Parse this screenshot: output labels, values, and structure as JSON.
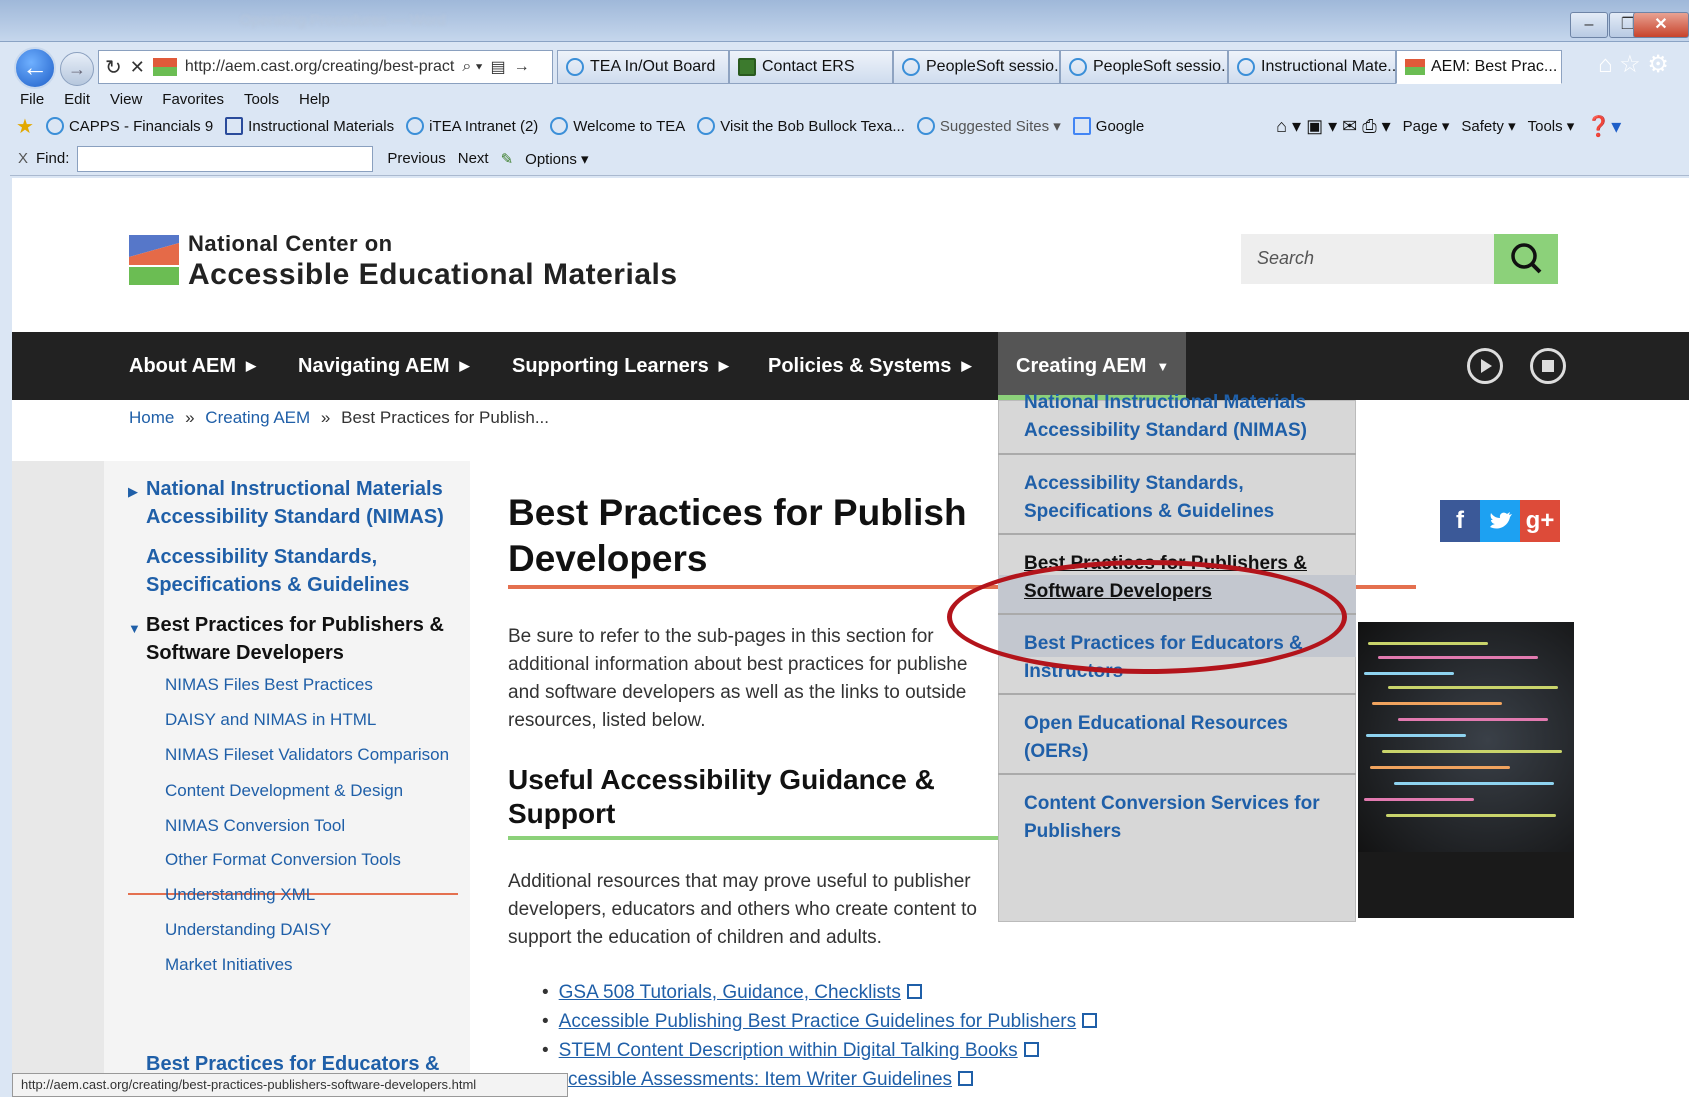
{
  "browser": {
    "address_url": "http://aem.cast.org/creating/best-pract",
    "tabs": [
      {
        "label": "TEA In/Out Board"
      },
      {
        "label": "Contact ERS"
      },
      {
        "label": "PeopleSoft sessio..."
      },
      {
        "label": "PeopleSoft sessio..."
      },
      {
        "label": "Instructional Mate..."
      },
      {
        "label": "AEM: Best Prac...",
        "close": "×"
      }
    ],
    "menu": [
      "File",
      "Edit",
      "View",
      "Favorites",
      "Tools",
      "Help"
    ],
    "favorites": [
      "CAPPS - Financials 9",
      "Instructional Materials",
      "iTEA Intranet (2)",
      "Welcome to TEA",
      "Visit the Bob Bullock Texa...",
      "Suggested Sites ▾",
      "Google"
    ],
    "command_bar": [
      "Page ▾",
      "Safety ▾",
      "Tools ▾"
    ],
    "find": {
      "close": "X",
      "label": "Find:",
      "previous": "Previous",
      "next": "Next",
      "options": "Options ▾"
    },
    "status_url": "http://aem.cast.org/creating/best-practices-publishers-software-developers.html"
  },
  "site": {
    "logo_line1": "National Center on",
    "logo_line2": "Accessible Educational Materials",
    "search_placeholder": "Search",
    "nav": [
      "About AEM",
      "Navigating AEM",
      "Supporting Learners",
      "Policies & Systems",
      "Creating AEM"
    ],
    "breadcrumb": {
      "home": "Home",
      "sep": "»",
      "section": "Creating AEM",
      "current": "Best Practices for Publish..."
    },
    "dropdown": [
      "National Instructional Materials Accessibility Standard (NIMAS)",
      "Accessibility Standards, Specifications & Guidelines",
      "Best Practices for Publishers & Software Developers",
      "Best Practices for Educators & Instructors",
      "Open Educational Resources (OERs)",
      "Content Conversion Services for Publishers"
    ],
    "sidebar": {
      "item1": "National Instructional Materials Accessibility Standard (NIMAS)",
      "item2": "Accessibility Standards, Specifications & Guidelines",
      "item3": "Best Practices for Publishers & Software Developers",
      "sub": [
        "NIMAS Files Best Practices",
        "DAISY and NIMAS in HTML",
        "NIMAS Fileset Validators Comparison",
        "Content Development & Design",
        "NIMAS Conversion Tool",
        "Other Format Conversion Tools",
        "Understanding XML",
        "Understanding DAISY",
        "Market Initiatives"
      ],
      "item4": "Best Practices for Educators &"
    },
    "main": {
      "title_line1": "Best Practices for Publish",
      "title_line2": "Developers",
      "intro": [
        "Be sure to refer to the sub-pages in this section for",
        "additional information about best practices for publishe",
        "and software developers as well as the links to outside",
        "resources, listed below."
      ],
      "h2_line1": "Useful Accessibility Guidance &",
      "h2_line2": "Support",
      "para2": [
        "Additional resources that may prove useful to publisher",
        "developers, educators and others who create content to",
        "support the education of children and adults."
      ],
      "resources": [
        "GSA 508 Tutorials, Guidance, Checklists",
        "Accessible Publishing Best Practice Guidelines for Publishers",
        "STEM Content Description within Digital Talking Books",
        "cessible Assessments: Item Writer Guidelines"
      ]
    },
    "social": [
      "f",
      "g+"
    ]
  }
}
